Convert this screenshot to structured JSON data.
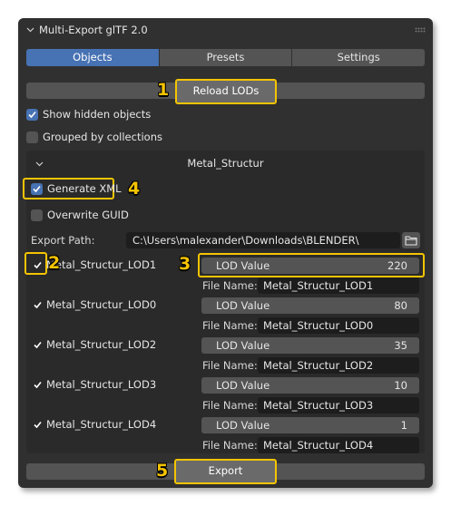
{
  "panel": {
    "title": "Multi-Export glTF 2.0",
    "tabs": [
      {
        "label": "Objects",
        "active": true
      },
      {
        "label": "Presets",
        "active": false
      },
      {
        "label": "Settings",
        "active": false
      }
    ],
    "reload_button": "Reload LODs",
    "show_hidden": {
      "label": "Show hidden objects",
      "checked": true
    },
    "grouped": {
      "label": "Grouped by collections",
      "checked": false
    },
    "export_button": "Export"
  },
  "object_group": {
    "name": "Metal_Structur",
    "generate_xml": {
      "label": "Generate XML",
      "checked": true
    },
    "overwrite_guid": {
      "label": "Overwrite GUID",
      "checked": false
    },
    "export_path": {
      "label": "Export Path:",
      "value": "C:\\Users\\malexander\\Downloads\\BLENDER\\"
    },
    "lods": [
      {
        "name": "Metal_Structur_LOD1",
        "checked": true,
        "lod_label": "LOD Value",
        "lod_value": "220",
        "file_label": "File Name:",
        "file_name": "Metal_Structur_LOD1"
      },
      {
        "name": "Metal_Structur_LOD0",
        "checked": true,
        "lod_label": "LOD Value",
        "lod_value": "80",
        "file_label": "File Name:",
        "file_name": "Metal_Structur_LOD0"
      },
      {
        "name": "Metal_Structur_LOD2",
        "checked": true,
        "lod_label": "LOD Value",
        "lod_value": "35",
        "file_label": "File Name:",
        "file_name": "Metal_Structur_LOD2"
      },
      {
        "name": "Metal_Structur_LOD3",
        "checked": true,
        "lod_label": "LOD Value",
        "lod_value": "10",
        "file_label": "File Name:",
        "file_name": "Metal_Structur_LOD3"
      },
      {
        "name": "Metal_Structur_LOD4",
        "checked": true,
        "lod_label": "LOD Value",
        "lod_value": "1",
        "file_label": "File Name:",
        "file_name": "Metal_Structur_LOD4"
      }
    ]
  },
  "callouts": [
    "1",
    "2",
    "3",
    "4",
    "5"
  ],
  "colors": {
    "accent": "#4772b3",
    "highlight": "#f5c400",
    "panel_bg": "#303030"
  },
  "icons": [
    "chevron-down-icon",
    "grip-icon",
    "checkmark-icon",
    "folder-icon"
  ]
}
